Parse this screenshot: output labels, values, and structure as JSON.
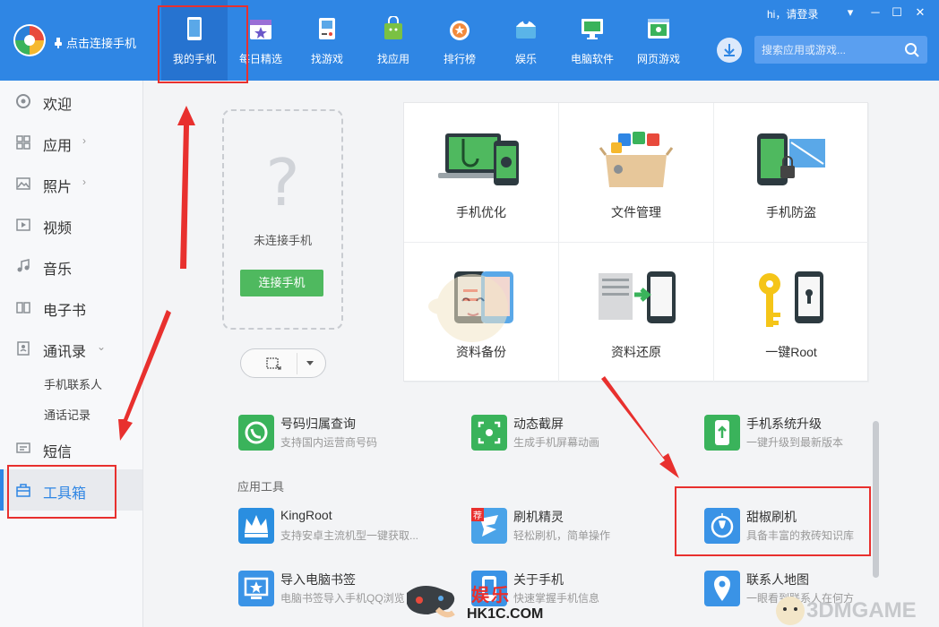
{
  "header": {
    "connect_link": "点击连接手机",
    "tabs": [
      {
        "label": "我的手机",
        "icon": "tablet-icon",
        "active": true
      },
      {
        "label": "每日精选",
        "icon": "calendar-star-icon"
      },
      {
        "label": "找游戏",
        "icon": "gamepad-icon"
      },
      {
        "label": "找应用",
        "icon": "android-bag-icon"
      },
      {
        "label": "排行榜",
        "icon": "medal-icon"
      },
      {
        "label": "娱乐",
        "icon": "entertainment-icon"
      },
      {
        "label": "电脑软件",
        "icon": "monitor-icon"
      },
      {
        "label": "网页游戏",
        "icon": "web-game-icon"
      }
    ],
    "login": "hi，请登录",
    "search_placeholder": "搜索应用或游戏..."
  },
  "sidebar": {
    "items": [
      {
        "label": "欢迎",
        "icon": "welcome-icon"
      },
      {
        "label": "应用",
        "icon": "apps-grid-icon",
        "chevron": "›"
      },
      {
        "label": "照片",
        "icon": "photo-icon",
        "chevron": "›"
      },
      {
        "label": "视频",
        "icon": "video-icon"
      },
      {
        "label": "音乐",
        "icon": "music-icon"
      },
      {
        "label": "电子书",
        "icon": "book-icon"
      },
      {
        "label": "通讯录",
        "icon": "contacts-icon",
        "chevron": "⌄"
      },
      {
        "label": "短信",
        "icon": "sms-icon"
      },
      {
        "label": "工具箱",
        "icon": "toolbox-icon",
        "active": true
      }
    ],
    "sub_items": [
      "手机联系人",
      "通话记录"
    ]
  },
  "phone_card": {
    "placeholder": "?",
    "status": "未连接手机",
    "connect_button": "连接手机"
  },
  "feature_grid": [
    {
      "label": "手机优化",
      "icon": "phone-optimize-icon"
    },
    {
      "label": "文件管理",
      "icon": "file-manager-icon"
    },
    {
      "label": "手机防盗",
      "icon": "phone-antitheft-icon"
    },
    {
      "label": "资料备份",
      "icon": "data-backup-icon"
    },
    {
      "label": "资料还原",
      "icon": "data-restore-icon"
    },
    {
      "label": "一键Root",
      "icon": "root-key-icon"
    }
  ],
  "tools_top": [
    {
      "name": "号码归属查询",
      "desc": "支持国内运营商号码",
      "color": "#3ab35b",
      "icon": "phone-lookup-icon"
    },
    {
      "name": "动态截屏",
      "desc": "生成手机屏幕动画",
      "color": "#3ab35b",
      "icon": "screen-capture-icon"
    },
    {
      "name": "手机系统升级",
      "desc": "一键升级到最新版本",
      "color": "#3ab35b",
      "icon": "system-upgrade-icon"
    }
  ],
  "section_title": "应用工具",
  "tools_apps": [
    {
      "name": "KingRoot",
      "desc": "支持安卓主流机型一键获取...",
      "color": "#2a8ee0",
      "icon": "crown-icon"
    },
    {
      "name": "刷机精灵",
      "desc": "轻松刷机，简单操作",
      "color": "#4aa3e8",
      "icon": "flash-elf-icon",
      "badge": "荐"
    },
    {
      "name": "甜椒刷机",
      "desc": "具备丰富的救砖知识库",
      "color": "#3a93e6",
      "icon": "pepper-flash-icon"
    },
    {
      "name": "导入电脑书签",
      "desc": "电脑书签导入手机QQ浏览",
      "color": "#3a93e6",
      "icon": "bookmark-icon"
    },
    {
      "name": "关于手机",
      "desc": "快速掌握手机信息",
      "color": "#3a93e6",
      "icon": "about-phone-icon"
    },
    {
      "name": "联系人地图",
      "desc": "一眼看到联系人在何方",
      "color": "#3a93e6",
      "icon": "contact-map-icon"
    }
  ],
  "watermarks": {
    "playfun": "娱乐",
    "hk1c": "HK1C.COM",
    "gamesite": "3DMGAME"
  },
  "colors": {
    "brand_blue": "#2f86e4",
    "annotation_red": "#e8302e",
    "connect_green": "#4fb95f"
  }
}
